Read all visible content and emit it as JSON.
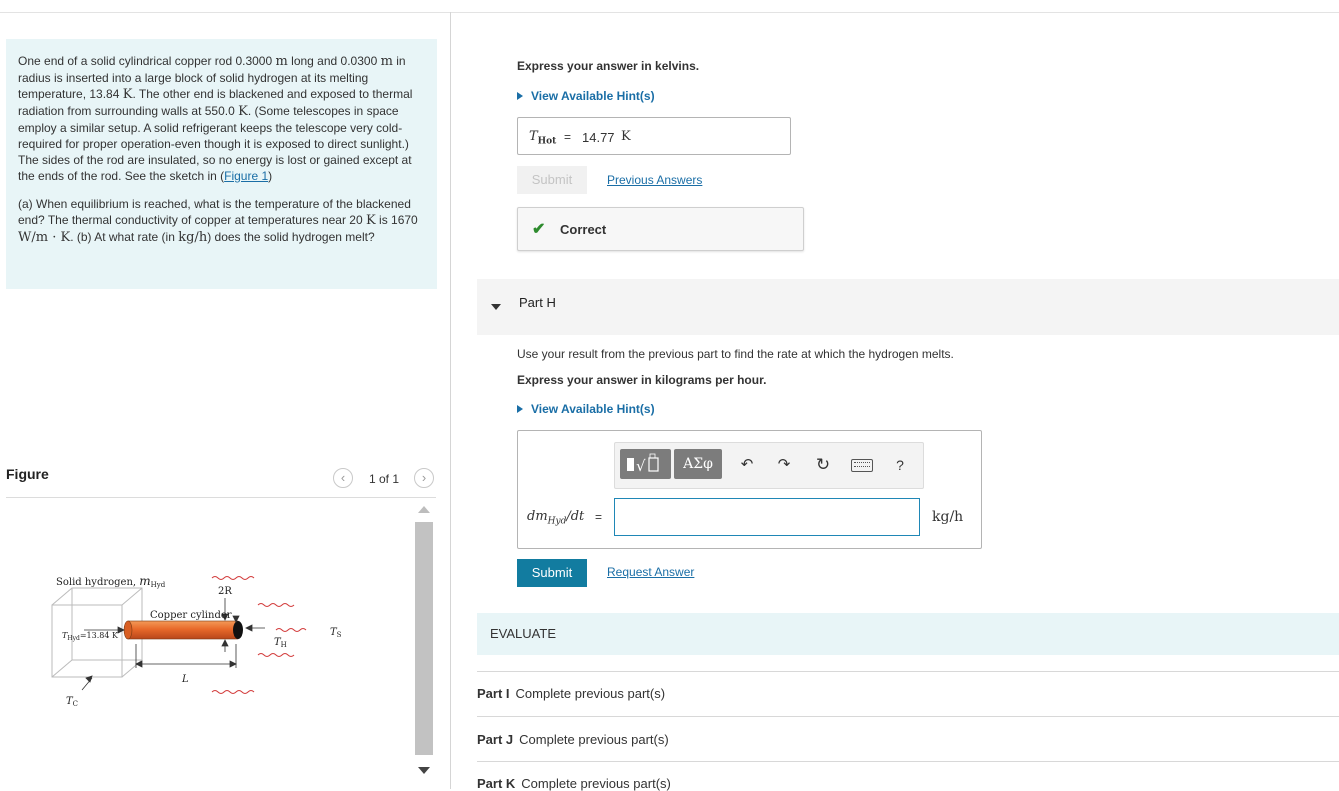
{
  "problem": {
    "paragraph1_a": "One end of a solid cylindrical copper rod 0.3000 ",
    "unit_m1": "m",
    "paragraph1_b": " long and 0.0300 ",
    "unit_m2": "m",
    "paragraph1_c": " in radius is inserted into a large block of solid hydrogen at its melting temperature, 13.84 ",
    "unit_K1": "K",
    "paragraph1_d": ". The other end is blackened and exposed to thermal radiation from surrounding walls at 550.0 ",
    "unit_K2": "K",
    "paragraph1_e": ". (Some telescopes in space employ a similar setup. A solid refrigerant keeps the telescope very cold-required for proper operation-even though it is exposed to direct sunlight.) The sides of the rod are insulated, so no energy is lost or gained except at the ends of the rod. See the sketch in (",
    "figure_link": "Figure 1",
    "paragraph1_f": ")",
    "paragraph2_a": "(a) When equilibrium is reached, what is the temperature of the blackened end? The thermal conductivity of copper at temperatures near 20 ",
    "unit_K3": "K",
    "paragraph2_b": " is 1670 ",
    "unit_wmk": "W/m · K",
    "paragraph2_c": ". (b) At what rate  (in ",
    "unit_kgh": "kg/h",
    "paragraph2_d": ") does the solid hydrogen melt?"
  },
  "figure": {
    "title": "Figure",
    "pager_text": "1 of 1",
    "labels": {
      "solid_hydrogen": "Solid hydrogen, ",
      "m": "m",
      "m_sub": "Hyd",
      "two_r": "2R",
      "copper": "Copper cylinder",
      "t_hyd": "T",
      "t_hyd_sub": "Hyd",
      "t_hyd_val": "=13.84 K",
      "ts": "T",
      "ts_sub": "S",
      "th": "T",
      "th_sub": "H",
      "l": "L",
      "tc": "T",
      "tc_sub": "C"
    }
  },
  "part_g": {
    "express": "Express your answer in kelvins.",
    "hint": "View Available Hint(s)",
    "var": "T",
    "var_sub": "Hot",
    "eq": "=",
    "value": "14.77",
    "unit": "K",
    "submit": "Submit",
    "previous": "Previous Answers",
    "feedback": "Correct"
  },
  "part_h": {
    "title": "Part H",
    "instruction": "Use your result from the previous part to find the rate at which the hydrogen melts.",
    "express": "Express your answer in kilograms per hour.",
    "hint": "View Available Hint(s)",
    "toolbar": {
      "greek": "ΑΣφ",
      "help": "?"
    },
    "var_prefix": "dm",
    "var_sub": "Hyd",
    "var_suffix": "/dt",
    "eq": "=",
    "input_value": "",
    "unit": "kg/h",
    "submit": "Submit",
    "request": "Request Answer"
  },
  "evaluate": {
    "label": "EVALUATE"
  },
  "parts": [
    {
      "name": "Part I",
      "status": "Complete previous part(s)"
    },
    {
      "name": "Part J",
      "status": "Complete previous part(s)"
    },
    {
      "name": "Part K",
      "status": "Complete previous part(s)"
    }
  ],
  "colors": {
    "accent": "#127ca0",
    "link": "#1a6ea6",
    "problem_bg": "#e8f5f7",
    "correct": "#2e8b2e"
  }
}
